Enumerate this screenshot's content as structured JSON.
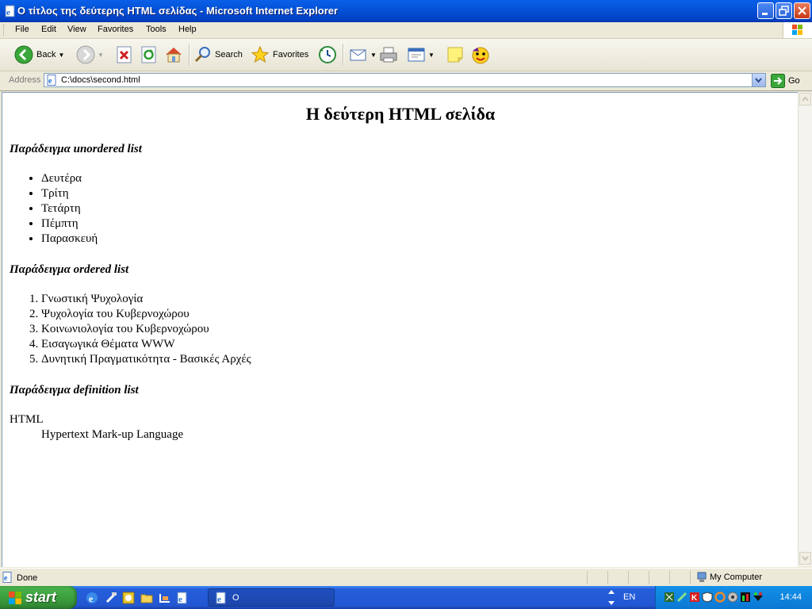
{
  "window": {
    "title": "Ο τίτλος της δεύτερης HTML σελίδας - Microsoft Internet Explorer"
  },
  "menu": {
    "items": [
      "File",
      "Edit",
      "View",
      "Favorites",
      "Tools",
      "Help"
    ]
  },
  "toolbar": {
    "back_label": "Back",
    "search_label": "Search",
    "favorites_label": "Favorites"
  },
  "address": {
    "label": "Address",
    "url": "C:\\docs\\second.html",
    "go_label": "Go"
  },
  "page": {
    "heading": "Η δεύτερη HTML σελίδα",
    "unordered_title": "Παράδειγμα unordered list",
    "unordered_items": [
      "Δευτέρα",
      "Τρίτη",
      "Τετάρτη",
      "Πέμπτη",
      "Παρασκευή"
    ],
    "ordered_title": "Παράδειγμα ordered list",
    "ordered_items": [
      "Γνωστική Ψυχολογία",
      "Ψυχολογία του Κυβερνοχώρου",
      "Κοινωνιολογία του Κυβερνοχώρου",
      "Εισαγωγικά Θέματα WWW",
      "Δυνητική Πραγματικότητα - Βασικές Αρχές"
    ],
    "definition_title": "Παράδειγμα definition list",
    "definition_term": "HTML",
    "definition_desc": "Hypertext Mark-up Language"
  },
  "status": {
    "text": "Done",
    "zone": "My Computer"
  },
  "taskbar": {
    "start_label": "start",
    "task_label": "O",
    "language": "EN",
    "clock": "14:44"
  },
  "colors": {
    "titlebar": "#0453D9",
    "taskbar": "#245EDB",
    "start": "#3A9B3C",
    "chrome": "#ECE9D8"
  }
}
